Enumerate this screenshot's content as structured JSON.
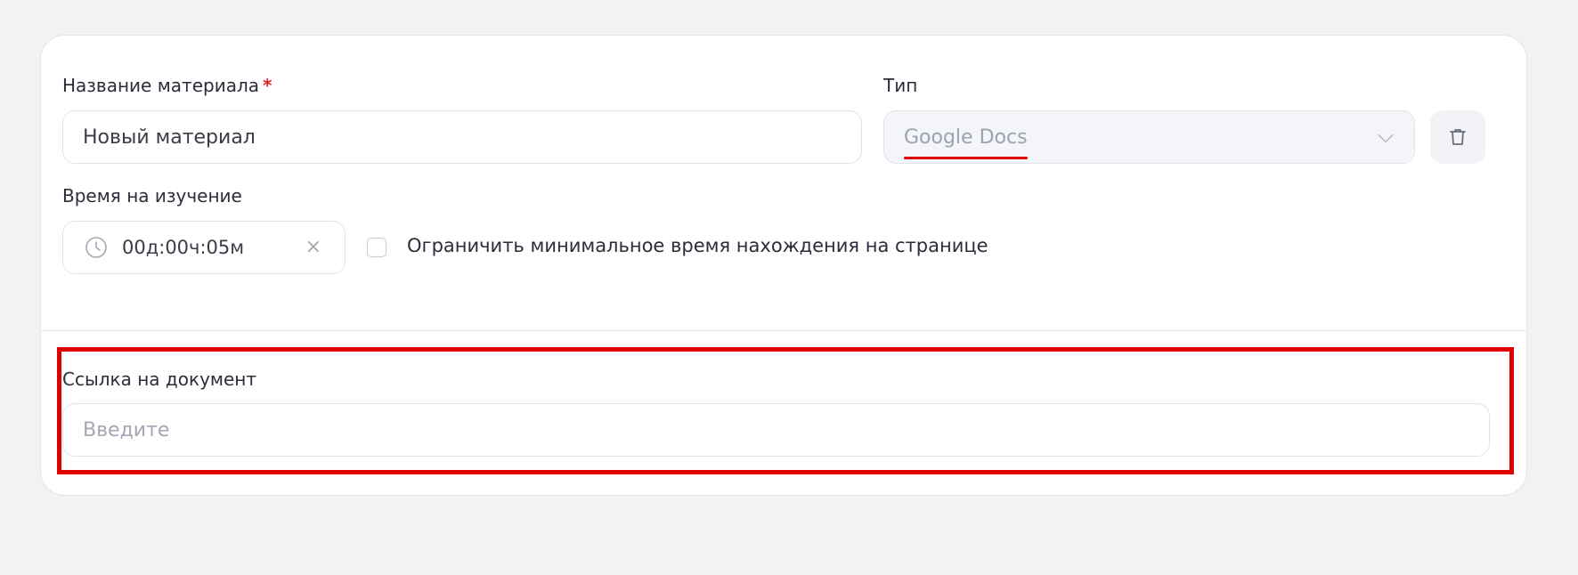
{
  "form": {
    "name_field": {
      "label": "Название материала",
      "required_mark": "*",
      "value": "Новый материал"
    },
    "type_field": {
      "label": "Тип",
      "value": "Google Docs"
    },
    "time_field": {
      "label": "Время на изучение",
      "value": "00д:00ч:05м",
      "clear_glyph": "×"
    },
    "min_time_checkbox": {
      "label": "Ограничить минимальное время нахождения на странице",
      "checked": false
    },
    "link_field": {
      "label": "Ссылка на документ",
      "placeholder": "Введите"
    }
  },
  "icons": {
    "delete": "trash-icon",
    "time": "clock-icon",
    "dropdown": "chevron-down-icon",
    "clear": "close-icon"
  },
  "colors": {
    "highlight": "#e00000",
    "required": "#e02424",
    "page_background": "#f2f2f4"
  }
}
